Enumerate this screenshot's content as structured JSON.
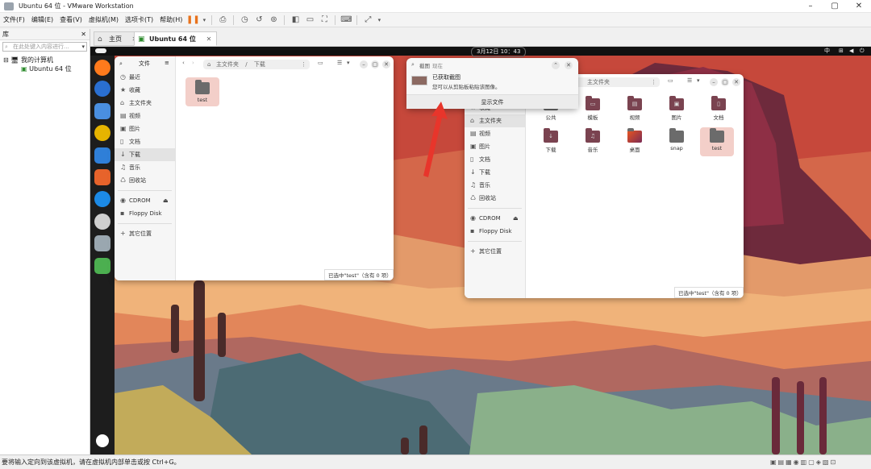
{
  "window": {
    "title": "Ubuntu 64 位 - VMware Workstation"
  },
  "menu": [
    "文件(F)",
    "编辑(E)",
    "查看(V)",
    "虚拟机(M)",
    "选项卡(T)",
    "帮助(H)"
  ],
  "library": {
    "header": "库",
    "search_placeholder": "在此处键入内容进行...",
    "tree_root": "我的计算机",
    "tree_vm": "Ubuntu 64 位"
  },
  "tabs": [
    {
      "label": "主页"
    },
    {
      "label": "Ubuntu 64 位"
    }
  ],
  "ubuntu": {
    "clock": "3月12日  10：43",
    "lang": "中"
  },
  "files_left": {
    "title": "文件",
    "path_home": "主文件夹",
    "path_current": "下载",
    "sidebar": [
      "最近",
      "收藏",
      "主文件夹",
      "视频",
      "图片",
      "文档",
      "下载",
      "音乐",
      "回收站"
    ],
    "devices": [
      "CDROM",
      "Floppy Disk"
    ],
    "other": "其它位置",
    "folder": "test",
    "status": "已选中\"test\"（含有 0 项）"
  },
  "files_right": {
    "path": "主文件夹",
    "sidebar": [
      "收藏",
      "主文件夹",
      "视频",
      "图片",
      "文档",
      "下载",
      "音乐",
      "回收站"
    ],
    "devices": [
      "CDROM",
      "Floppy Disk"
    ],
    "other": "其它位置",
    "folders": [
      "公共",
      "模板",
      "视频",
      "图片",
      "文档",
      "下载",
      "音乐",
      "桌面",
      "snap",
      "test"
    ],
    "status": "已选中\"test\"（含有 0 项）"
  },
  "notification": {
    "app": "截图",
    "time": "现在",
    "title": "已获取截图",
    "body": "您可以从剪贴板粘贴该图像。",
    "action": "显示文件"
  },
  "statusbar": {
    "text": "要将输入定向到该虚拟机，请在虚拟机内部单击或按 Ctrl+G。"
  },
  "colors": {
    "accent": "#e95420",
    "annotation_arrow": "#e8352b"
  }
}
